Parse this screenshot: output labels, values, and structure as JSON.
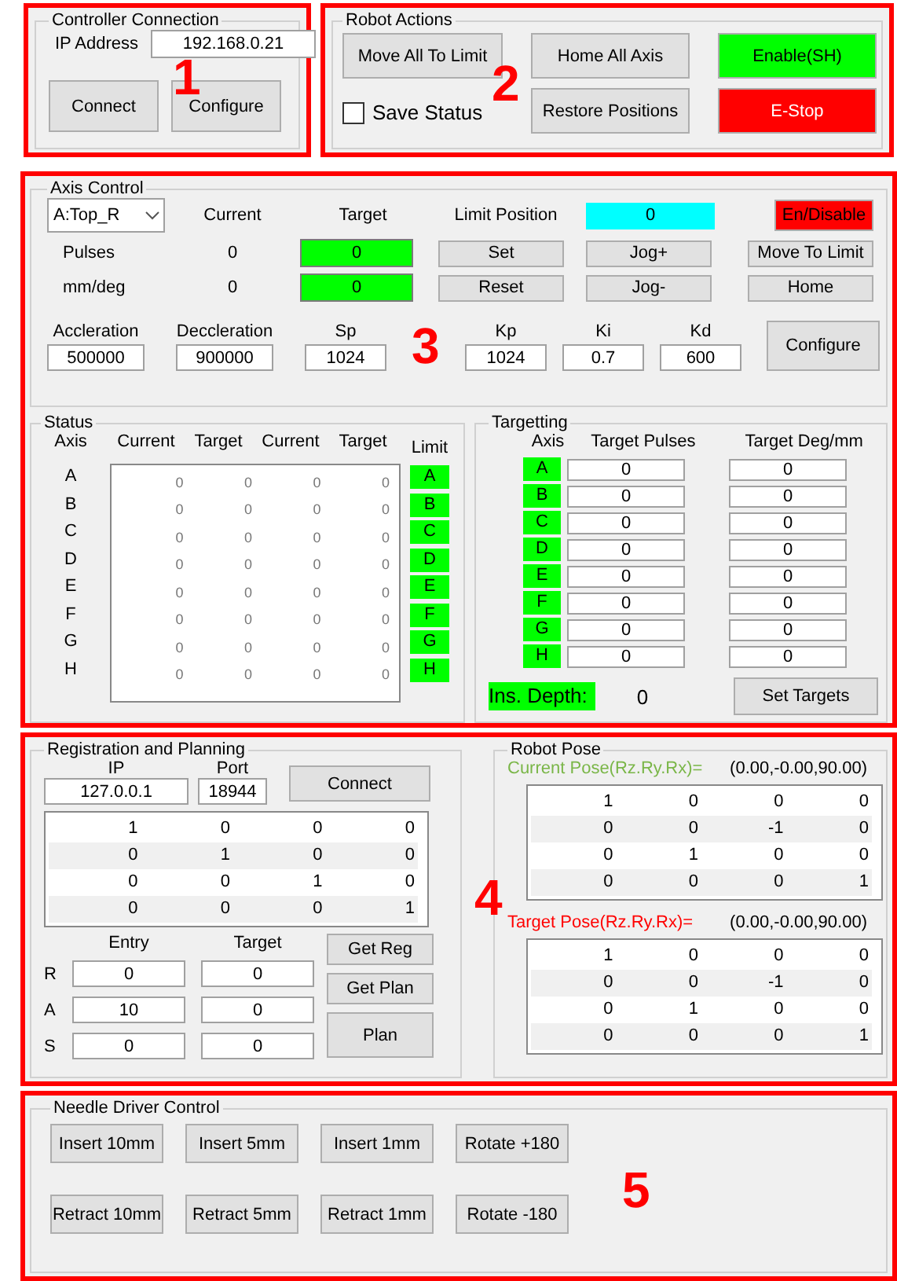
{
  "controller_connection": {
    "title": "Controller Connection",
    "ip_label": "IP Address",
    "ip_value": "192.168.0.21",
    "buttons": [
      "Connect",
      "Configure"
    ],
    "callout": "1"
  },
  "robot_actions": {
    "title": "Robot Actions",
    "move_all": "Move All To Limit",
    "home_all": "Home All Axis",
    "restore": "Restore Positions",
    "enable": "Enable(SH)",
    "estop": "E-Stop",
    "save_status": {
      "label": "Save Status",
      "checked": false
    },
    "callout": "2"
  },
  "axis_control": {
    "title": "Axis Control",
    "axis_select": "A:Top_R",
    "headers": [
      "Current",
      "Target"
    ],
    "limit_label": "Limit Position",
    "limit_value": "0",
    "enable_button": "En/Disable",
    "rows": [
      {
        "label": "Pulses",
        "current": "0",
        "target": "0",
        "set_button": "Set",
        "jog_button": "Jog+",
        "move_button": "Move To Limit"
      },
      {
        "label": "mm/deg",
        "current": "0",
        "target": "0",
        "set_button": "Reset",
        "jog_button": "Jog-",
        "move_button": "Home"
      }
    ],
    "params": [
      {
        "label": "Accleration",
        "value": "500000"
      },
      {
        "label": "Deccleration",
        "value": "900000"
      },
      {
        "label": "Sp",
        "value": "1024"
      },
      {
        "label": "Kp",
        "value": "1024"
      },
      {
        "label": "Ki",
        "value": "0.7"
      },
      {
        "label": "Kd",
        "value": "600"
      }
    ],
    "configure_button": "Configure",
    "callout": "3"
  },
  "status": {
    "title": "Status",
    "columns": [
      "Axis",
      "Current",
      "Target",
      "Current",
      "Target",
      "Limit"
    ],
    "rows": [
      {
        "axis": "A",
        "values": [
          "0",
          "0",
          "0",
          "0"
        ],
        "limit": "A",
        "limit_triggered": false
      },
      {
        "axis": "B",
        "values": [
          "0",
          "0",
          "0",
          "0"
        ],
        "limit": "B",
        "limit_triggered": false
      },
      {
        "axis": "C",
        "values": [
          "0",
          "0",
          "0",
          "0"
        ],
        "limit": "C",
        "limit_triggered": false
      },
      {
        "axis": "D",
        "values": [
          "0",
          "0",
          "0",
          "0"
        ],
        "limit": "D",
        "limit_triggered": false
      },
      {
        "axis": "E",
        "values": [
          "0",
          "0",
          "0",
          "0"
        ],
        "limit": "E",
        "limit_triggered": false
      },
      {
        "axis": "F",
        "values": [
          "0",
          "0",
          "0",
          "0"
        ],
        "limit": "F",
        "limit_triggered": false
      },
      {
        "axis": "G",
        "values": [
          "0",
          "0",
          "0",
          "0"
        ],
        "limit": "G",
        "limit_triggered": false
      },
      {
        "axis": "H",
        "values": [
          "0",
          "0",
          "0",
          "0"
        ],
        "limit": "H",
        "limit_triggered": false
      }
    ]
  },
  "targetting": {
    "title": "Targetting",
    "columns": [
      "Axis",
      "Target Pulses",
      "Target Deg/mm"
    ],
    "rows": [
      {
        "axis": "A",
        "pulses": "0",
        "deg": "0"
      },
      {
        "axis": "B",
        "pulses": "0",
        "deg": "0"
      },
      {
        "axis": "C",
        "pulses": "0",
        "deg": "0"
      },
      {
        "axis": "D",
        "pulses": "0",
        "deg": "0"
      },
      {
        "axis": "E",
        "pulses": "0",
        "deg": "0"
      },
      {
        "axis": "F",
        "pulses": "0",
        "deg": "0"
      },
      {
        "axis": "G",
        "pulses": "0",
        "deg": "0"
      },
      {
        "axis": "H",
        "pulses": "0",
        "deg": "0"
      }
    ],
    "depth_label": "Ins. Depth:",
    "depth_value": "0",
    "set_button": "Set Targets"
  },
  "registration": {
    "title": "Registration and Planning",
    "ip_label": "IP",
    "ip_value": "127.0.0.1",
    "port_label": "Port",
    "port_value": "18944",
    "connect_button": "Connect",
    "matrix": [
      [
        "1",
        "0",
        "0",
        "0"
      ],
      [
        "0",
        "1",
        "0",
        "0"
      ],
      [
        "0",
        "0",
        "1",
        "0"
      ],
      [
        "0",
        "0",
        "0",
        "1"
      ]
    ],
    "entry_label": "Entry",
    "target_label": "Target",
    "points": [
      {
        "axis": "R",
        "entry": "0",
        "target": "0"
      },
      {
        "axis": "A",
        "entry": "10",
        "target": "0"
      },
      {
        "axis": "S",
        "entry": "0",
        "target": "0"
      }
    ],
    "buttons": [
      "Get Reg",
      "Get Plan",
      "Plan"
    ],
    "callout": "4"
  },
  "robot_pose": {
    "title": "Robot Pose",
    "poses": [
      {
        "label": "Current Pose(Rz.Ry.Rx)=",
        "value": "(0.00,-0.00,90.00)",
        "color": "#7ab648",
        "matrix": [
          [
            "1",
            "0",
            "0",
            "0"
          ],
          [
            "0",
            "0",
            "-1",
            "0"
          ],
          [
            "0",
            "1",
            "0",
            "0"
          ],
          [
            "0",
            "0",
            "0",
            "1"
          ]
        ]
      },
      {
        "label": "Target Pose(Rz.Ry.Rx)=",
        "value": "(0.00,-0.00,90.00)",
        "color": "#ff0000",
        "matrix": [
          [
            "1",
            "0",
            "0",
            "0"
          ],
          [
            "0",
            "0",
            "-1",
            "0"
          ],
          [
            "0",
            "1",
            "0",
            "0"
          ],
          [
            "0",
            "0",
            "0",
            "1"
          ]
        ]
      }
    ]
  },
  "needle_driver": {
    "title": "Needle Driver Control",
    "buttons": [
      [
        "Insert 10mm",
        "Insert 5mm",
        "Insert 1mm",
        "Rotate +180"
      ],
      [
        "Retract 10mm",
        "Retract 5mm",
        "Retract 1mm",
        "Rotate -180"
      ]
    ],
    "callout": "5"
  }
}
